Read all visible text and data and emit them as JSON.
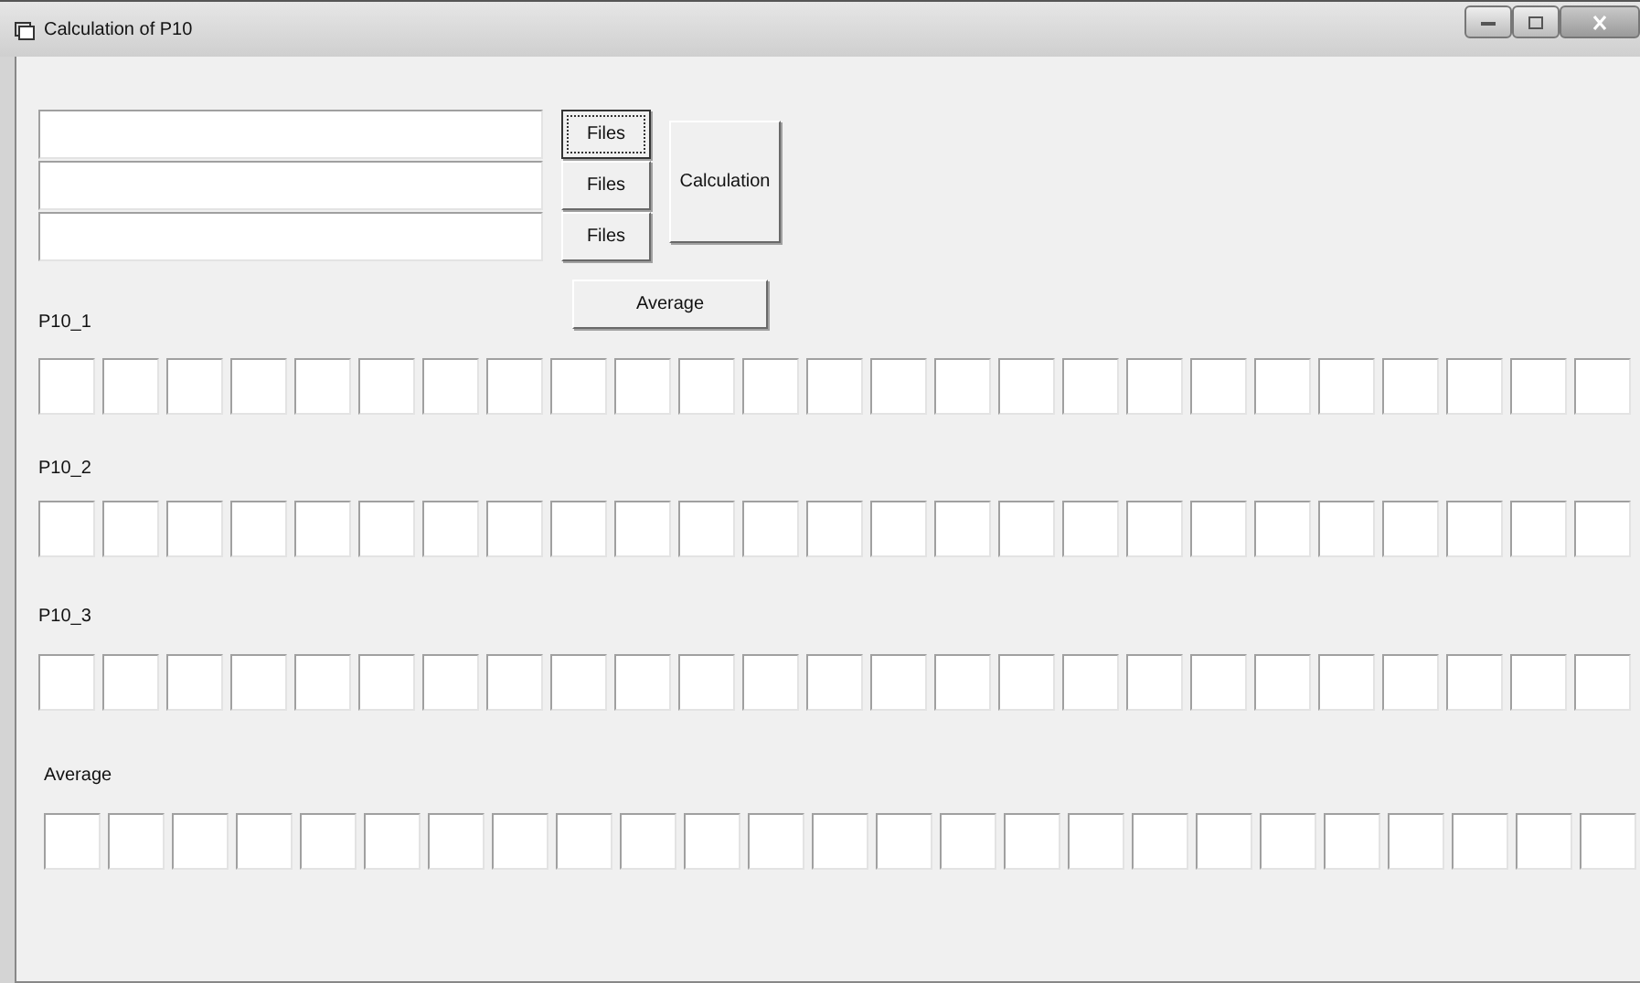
{
  "window": {
    "title": "Calculation of P10"
  },
  "file_rows": [
    {
      "button": "Files",
      "focused": true
    },
    {
      "button": "Files",
      "focused": false
    },
    {
      "button": "Files",
      "focused": false
    }
  ],
  "calculate_button": "Calculation",
  "average_button": "Average",
  "groups": [
    {
      "label": "P10_1"
    },
    {
      "label": "P10_2"
    },
    {
      "label": "P10_3"
    },
    {
      "label": "Average"
    }
  ]
}
